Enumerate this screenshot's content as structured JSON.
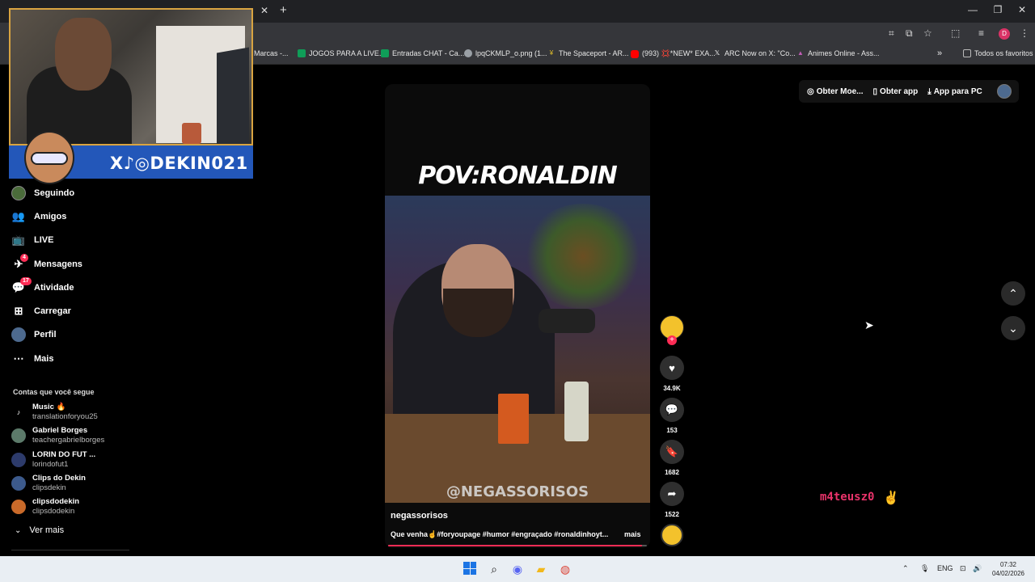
{
  "browser": {
    "bookmarks": [
      {
        "label": "Marcas -...",
        "icon": "folder-icon",
        "color": "#9aa0a6"
      },
      {
        "label": "JOGOS PARA A LIVE...",
        "icon": "sheets-icon",
        "color": "#0f9d58"
      },
      {
        "label": "Entradas CHAT - Ca...",
        "icon": "sheets-icon",
        "color": "#0f9d58"
      },
      {
        "label": "lpqCKMLP_o.png (1...",
        "icon": "globe-icon",
        "color": "#9aa0a6"
      },
      {
        "label": "The Spaceport - AR...",
        "icon": "spaceport-icon",
        "color": "#e6c229"
      },
      {
        "label": "(993) 💢*NEW* EXA...",
        "icon": "youtube-icon",
        "color": "#ff0000"
      },
      {
        "label": "ARC Now on X: \"Co...",
        "icon": "x-icon",
        "color": "#ffffff"
      },
      {
        "label": "Animes Online - Ass...",
        "icon": "anime-icon",
        "color": "#c05cb5"
      }
    ],
    "all_bookmarks": "Todos os favoritos",
    "profile_initial": "D"
  },
  "stream_overlay": {
    "banner_text": "X♪◎DEKIN021",
    "viewer_name": "m4teusz0"
  },
  "sidebar": {
    "nav": [
      {
        "label": "Seguindo",
        "icon": "following-icon"
      },
      {
        "label": "Amigos",
        "icon": "friends-icon"
      },
      {
        "label": "LIVE",
        "icon": "live-icon"
      },
      {
        "label": "Mensagens",
        "icon": "messages-icon",
        "badge": "4"
      },
      {
        "label": "Atividade",
        "icon": "activity-icon",
        "badge": "17"
      },
      {
        "label": "Carregar",
        "icon": "upload-icon"
      },
      {
        "label": "Perfil",
        "icon": "profile-icon"
      },
      {
        "label": "Mais",
        "icon": "more-icon"
      }
    ],
    "following_title": "Contas que você segue",
    "accounts": [
      {
        "name": "Music 🔥",
        "username": "translationforyou25"
      },
      {
        "name": "Gabriel Borges",
        "username": "teachergabrielborges"
      },
      {
        "name": "LORIN DO FUT ...",
        "username": "lorindofut1"
      },
      {
        "name": "Clips do Dekin",
        "username": "clipsdekin"
      },
      {
        "name": "clipsdodekin",
        "username": "clipsdodekin"
      }
    ],
    "see_more": "Ver mais"
  },
  "top_actions": {
    "coins": "Obter Moe...",
    "get_app": "Obter app",
    "pc_app": "App para PC"
  },
  "video": {
    "title_overlay": "POV:RONALDIN",
    "watermark": "@NEGASSORISOS",
    "author": "negassorisos",
    "caption": "Que venha☝️#foryoupage #humor #engraçado #ronaldinhoyt...",
    "more": "mais",
    "progress": 0.98,
    "likes": "34.9K",
    "comments": "153",
    "saves": "1682",
    "shares": "1522"
  },
  "taskbar": {
    "lang": "ENG",
    "time": "07:32",
    "date": "04/02/2026"
  }
}
